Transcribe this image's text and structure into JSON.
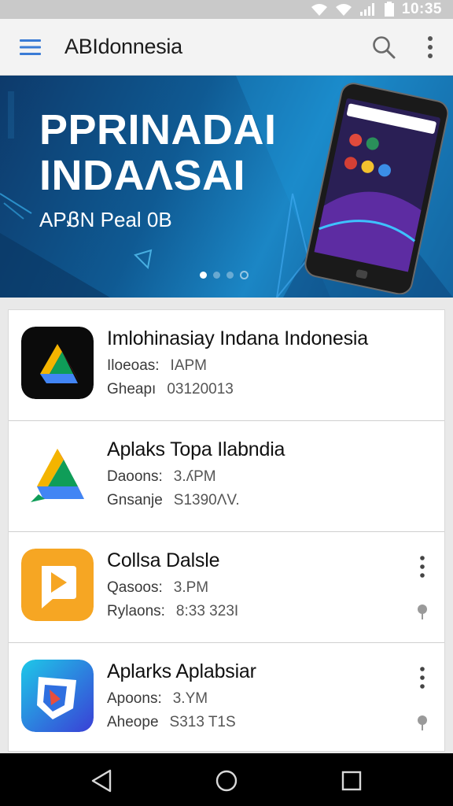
{
  "status_bar": {
    "time": "10:35",
    "icons": [
      "wifi-icon",
      "wifi-icon",
      "signal-icon",
      "battery-icon"
    ]
  },
  "app_bar": {
    "title": "ABIdonnesia",
    "icons": [
      "menu-icon",
      "search-icon",
      "overflow-menu-icon"
    ]
  },
  "banner": {
    "title": "PPRINADAI INDAɅSAI",
    "subtitle": "APᏰN Peal 0B",
    "slide_count": 4,
    "active_slide": 1
  },
  "apps": [
    {
      "title": "Imlohinasiay Indana Indonesia",
      "line1_label": "Iloeoas:",
      "line1_value": "IAPM",
      "line2_label": "Gheapı",
      "line2_value": "03120013",
      "icon": "drive-triangle-icon",
      "icon_bg": "#0b0b0b",
      "has_menu": false
    },
    {
      "title": "Aplaks Topa Ilabndia",
      "line1_label": "Daoons:",
      "line1_value": "3.ʎPM",
      "line2_label": "Gnsanje",
      "line2_value": "S1390ɅV.",
      "icon": "drive-triangle-icon",
      "icon_bg": "#ffffff",
      "has_menu": false
    },
    {
      "title": "Collsa Dalsle",
      "line1_label": "Qasoos:",
      "line1_value": "3.PM",
      "line2_label": "Rylaons:",
      "line2_value": "8:33 323I",
      "icon": "play-icon",
      "icon_bg": "#f6a623",
      "has_menu": true
    },
    {
      "title": "Aplarks Aplabsiar",
      "line1_label": "Apoons:",
      "line1_value": "3.YM",
      "line2_label": "Aheope",
      "line2_value": "S313 T1S",
      "icon": "shield-arrow-icon",
      "icon_bg": "#2f6fe0",
      "has_menu": true
    }
  ],
  "nav_bar": {
    "icons": [
      "back-icon",
      "home-icon",
      "recents-icon"
    ]
  },
  "colors": {
    "banner_dark": "#0d3a6b",
    "banner_light": "#1b86c5",
    "accent_blue": "#3a7bd5",
    "status_bar": "#c9c9c9"
  }
}
